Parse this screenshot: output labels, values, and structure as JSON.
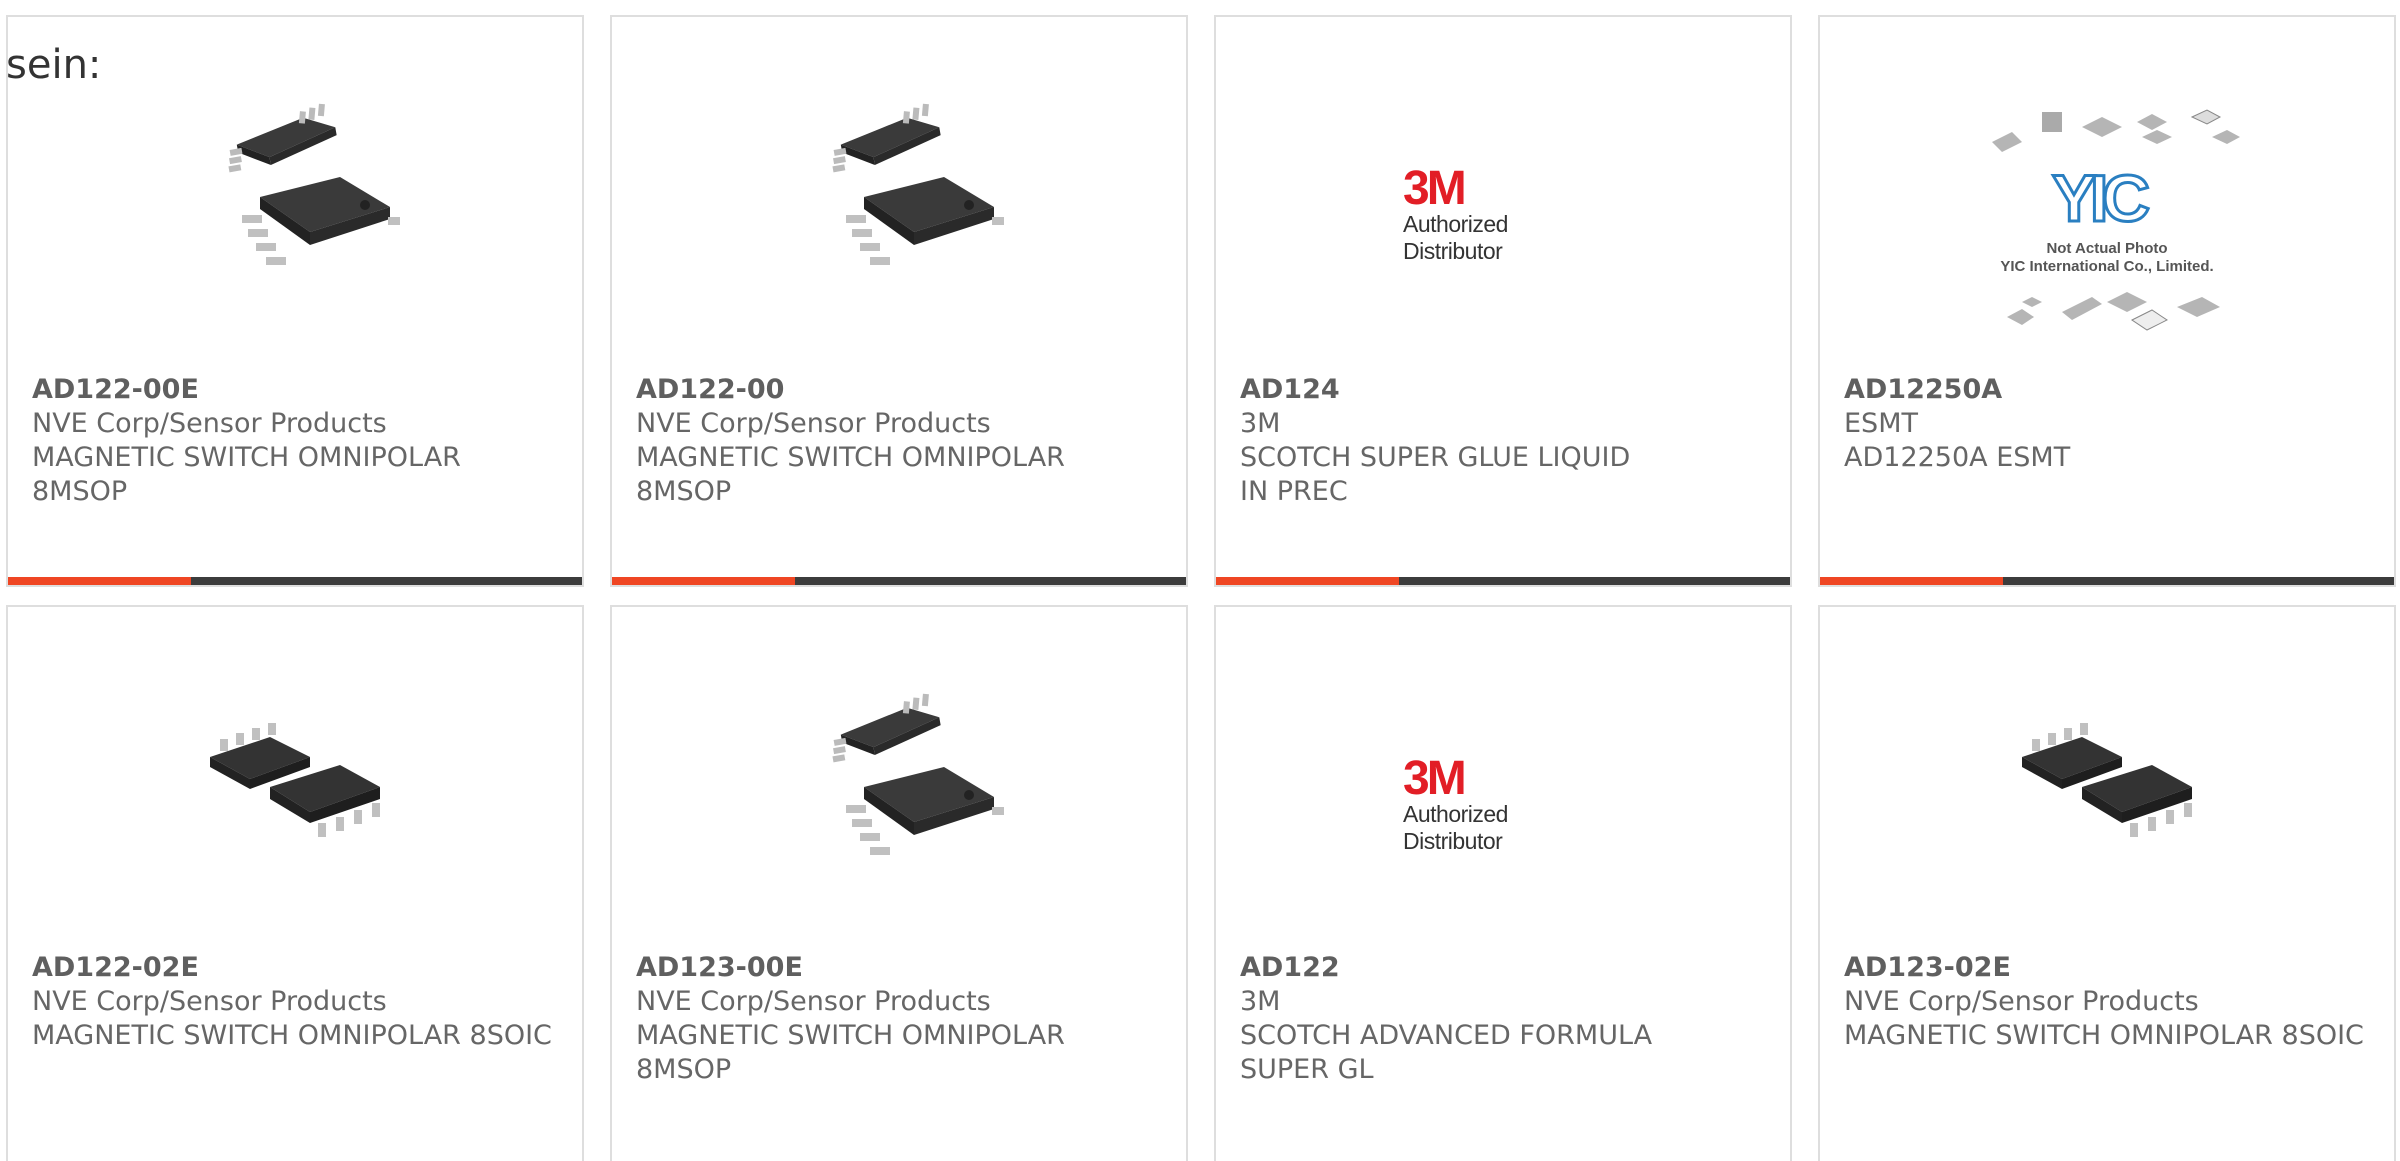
{
  "intro_text": "sein:",
  "cards": [
    {
      "pn": "AD122-00E",
      "maker": "NVE Corp/Sensor Products",
      "desc": "MAGNETIC SWITCH OMNIPOLAR 8MSOP",
      "image": "msop8-chip-pair"
    },
    {
      "pn": "AD122-00",
      "maker": "NVE Corp/Sensor Products",
      "desc": "MAGNETIC SWITCH OMNIPOLAR 8MSOP",
      "image": "msop8-chip-pair"
    },
    {
      "pn": "AD124",
      "maker": "3M",
      "desc": "SCOTCH SUPER GLUE LIQUID IN PREC",
      "image": "3m-logo",
      "brand_logo": "3M",
      "brand_caption": "Authorized Distributor"
    },
    {
      "pn": "AD12250A",
      "maker": "ESMT",
      "desc": "AD12250A ESMT",
      "image": "yic-placeholder",
      "placeholder_lines": [
        "Not Actual Photo",
        "YIC International Co., Limited."
      ],
      "placeholder_logo": "YIC"
    },
    {
      "pn": "AD122-02E",
      "maker": "NVE Corp/Sensor Products",
      "desc": "MAGNETIC SWITCH OMNIPOLAR 8SOIC",
      "image": "soic8-chip-pair"
    },
    {
      "pn": "AD123-00E",
      "maker": "NVE Corp/Sensor Products",
      "desc": "MAGNETIC SWITCH OMNIPOLAR 8MSOP",
      "image": "msop8-chip-pair"
    },
    {
      "pn": "AD122",
      "maker": "3M",
      "desc": "SCOTCH ADVANCED FORMULA SUPER GL",
      "image": "3m-logo",
      "brand_logo": "3M",
      "brand_caption": "Authorized Distributor"
    },
    {
      "pn": "AD123-02E",
      "maker": "NVE Corp/Sensor Products",
      "desc": "MAGNETIC SWITCH OMNIPOLAR 8SOIC",
      "image": "soic8-chip-pair"
    }
  ],
  "colors": {
    "accent": "#ef4623",
    "bar": "#3c3c3c",
    "card_border": "#dedede",
    "text": "#666666"
  }
}
